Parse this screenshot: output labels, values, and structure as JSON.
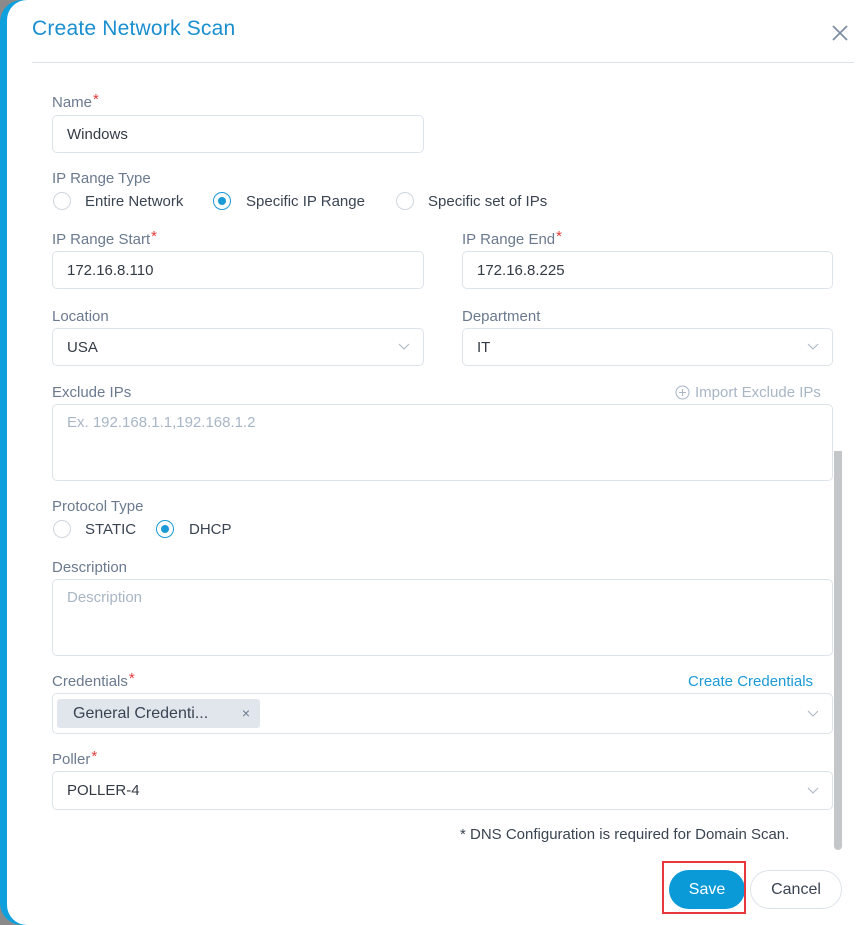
{
  "dialog": {
    "title": "Create Network Scan",
    "close_icon": "close-icon"
  },
  "form": {
    "name": {
      "label": "Name",
      "required": "*",
      "value": "Windows"
    },
    "ip_range_type": {
      "label": "IP Range Type",
      "options": [
        "Entire Network",
        "Specific IP Range",
        "Specific set of IPs"
      ],
      "selected": "Specific IP Range"
    },
    "ip_range_start": {
      "label": "IP Range Start",
      "required": "*",
      "value": "172.16.8.110"
    },
    "ip_range_end": {
      "label": "IP Range End",
      "required": "*",
      "value": "172.16.8.225"
    },
    "location": {
      "label": "Location",
      "value": "USA"
    },
    "department": {
      "label": "Department",
      "value": "IT"
    },
    "exclude_ips": {
      "label": "Exclude IPs",
      "placeholder": "Ex. 192.168.1.1,192.168.1.2",
      "import_link": "Import Exclude IPs",
      "import_icon": "plus-circle-icon"
    },
    "protocol_type": {
      "label": "Protocol Type",
      "options": [
        "STATIC",
        "DHCP"
      ],
      "selected": "DHCP"
    },
    "description": {
      "label": "Description",
      "placeholder": "Description"
    },
    "credentials": {
      "label": "Credentials",
      "required": "*",
      "create_link": "Create Credentials",
      "selected_tags": [
        "General Credenti..."
      ],
      "tag_remove": "×"
    },
    "poller": {
      "label": "Poller",
      "required": "*",
      "value": "POLLER-4"
    },
    "note": "* DNS Configuration is required for Domain Scan."
  },
  "footer": {
    "save_label": "Save",
    "cancel_label": "Cancel"
  },
  "colors": {
    "accent": "#0a9ad8",
    "title": "#1a8fd0",
    "required": "#e23b3b",
    "highlight": "#e8373d"
  }
}
